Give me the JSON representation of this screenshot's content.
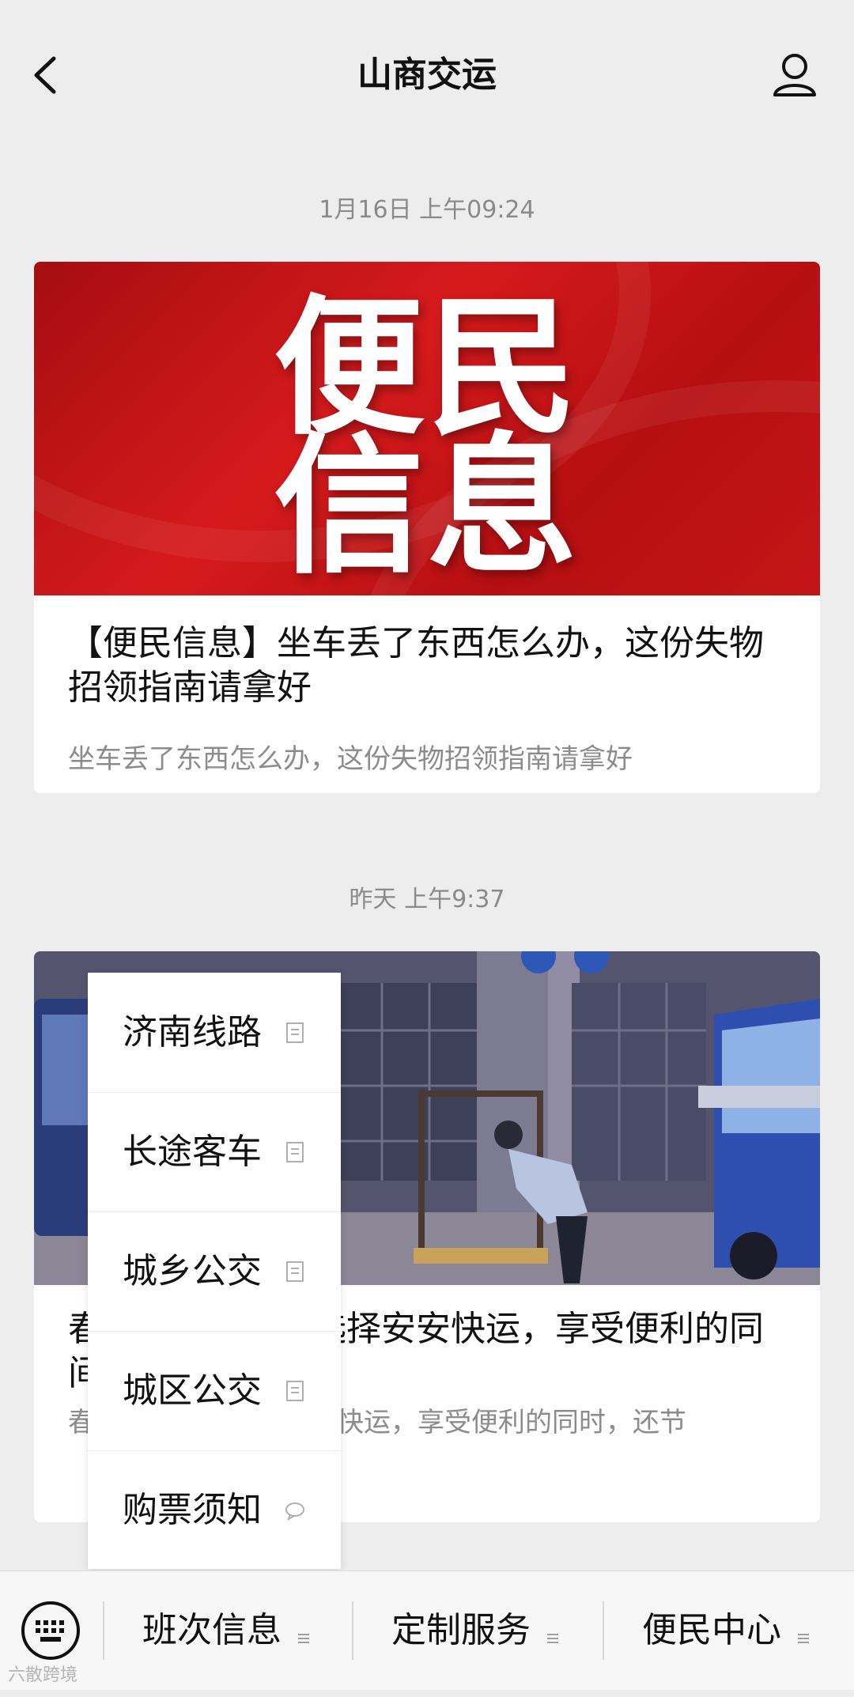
{
  "header": {
    "title": "山商交运",
    "back_icon": "chevron-left-icon",
    "profile_icon": "user-profile-icon"
  },
  "messages": [
    {
      "timestamp": "1月16日 上午09:24",
      "cover_line1": "便民",
      "cover_line2": "信息",
      "title": "【便民信息】坐车丢了东西怎么办，这份失物招领指南请拿好",
      "desc": "坐车丢了东西怎么办，这份失物招领指南请拿好"
    },
    {
      "timestamp": "昨天 上午9:37",
      "title": "春　　　　　　选择安安快运，享受便利的同　　　　　　　间和精力！",
      "desc": "春　　　　　　择安安快运，享受便利的同时，还节"
    }
  ],
  "popup_menu": {
    "items": [
      {
        "label": "济南线路",
        "icon": "document-icon"
      },
      {
        "label": "长途客车",
        "icon": "document-icon"
      },
      {
        "label": "城乡公交",
        "icon": "document-icon"
      },
      {
        "label": "城区公交",
        "icon": "document-icon"
      },
      {
        "label": "购票须知",
        "icon": "chat-bubble-icon"
      }
    ]
  },
  "bottom_menu": {
    "keyboard_icon": "keyboard-icon",
    "items": [
      {
        "label": "班次信息",
        "icon": "menu-lines-icon"
      },
      {
        "label": "定制服务",
        "icon": "menu-lines-icon"
      },
      {
        "label": "便民中心",
        "icon": "menu-lines-icon"
      }
    ]
  },
  "watermark": "六散跨境",
  "colors": {
    "background": "#ededed",
    "card": "#ffffff",
    "banner_red": "#c31516",
    "text_primary": "#111111",
    "text_secondary": "#8c8c8c"
  }
}
